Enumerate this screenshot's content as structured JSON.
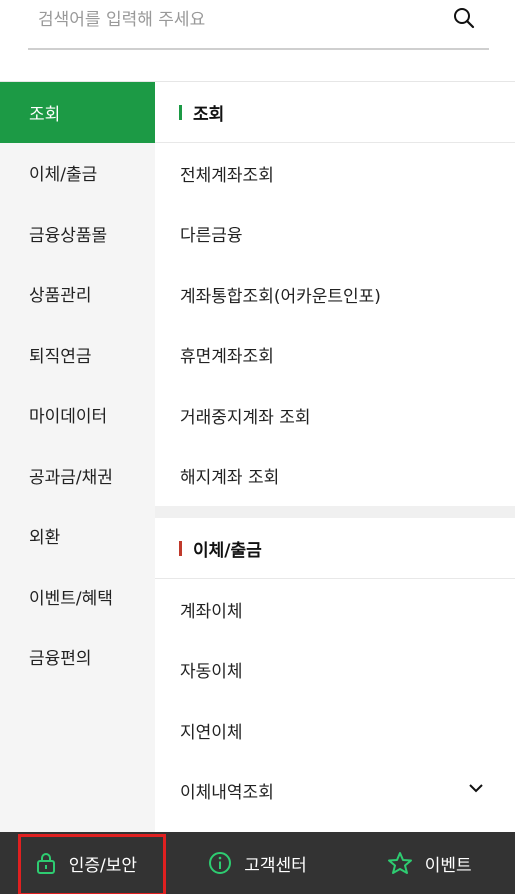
{
  "search": {
    "placeholder": "검색어를 입력해 주세요"
  },
  "left_nav": [
    {
      "label": "조회",
      "active": true
    },
    {
      "label": "이체/출금"
    },
    {
      "label": "금융상품몰"
    },
    {
      "label": "상품관리"
    },
    {
      "label": "퇴직연금"
    },
    {
      "label": "마이데이터"
    },
    {
      "label": "공과금/채권"
    },
    {
      "label": "외환"
    },
    {
      "label": "이벤트/혜택"
    },
    {
      "label": "금융편의"
    }
  ],
  "sections": [
    {
      "title": "조회",
      "bar_color": "#1c9a45",
      "items": [
        "전체계좌조회",
        "다른금융",
        "계좌통합조회(어카운트인포)",
        "휴면계좌조회",
        "거래중지계좌 조회",
        "해지계좌 조회"
      ]
    },
    {
      "title": "이체/출금",
      "bar_color": "#c0392b",
      "items": [
        "계좌이체",
        "자동이체",
        "지연이체",
        "이체내역조회"
      ]
    }
  ],
  "bottom_bar": [
    {
      "label": "인증/보안",
      "icon": "lock-icon"
    },
    {
      "label": "고객센터",
      "icon": "info-icon"
    },
    {
      "label": "이벤트",
      "icon": "star-icon"
    }
  ],
  "colors": {
    "accent": "#1c9a45",
    "bottom_bar_bg": "#333333",
    "highlight": "#e02020"
  }
}
